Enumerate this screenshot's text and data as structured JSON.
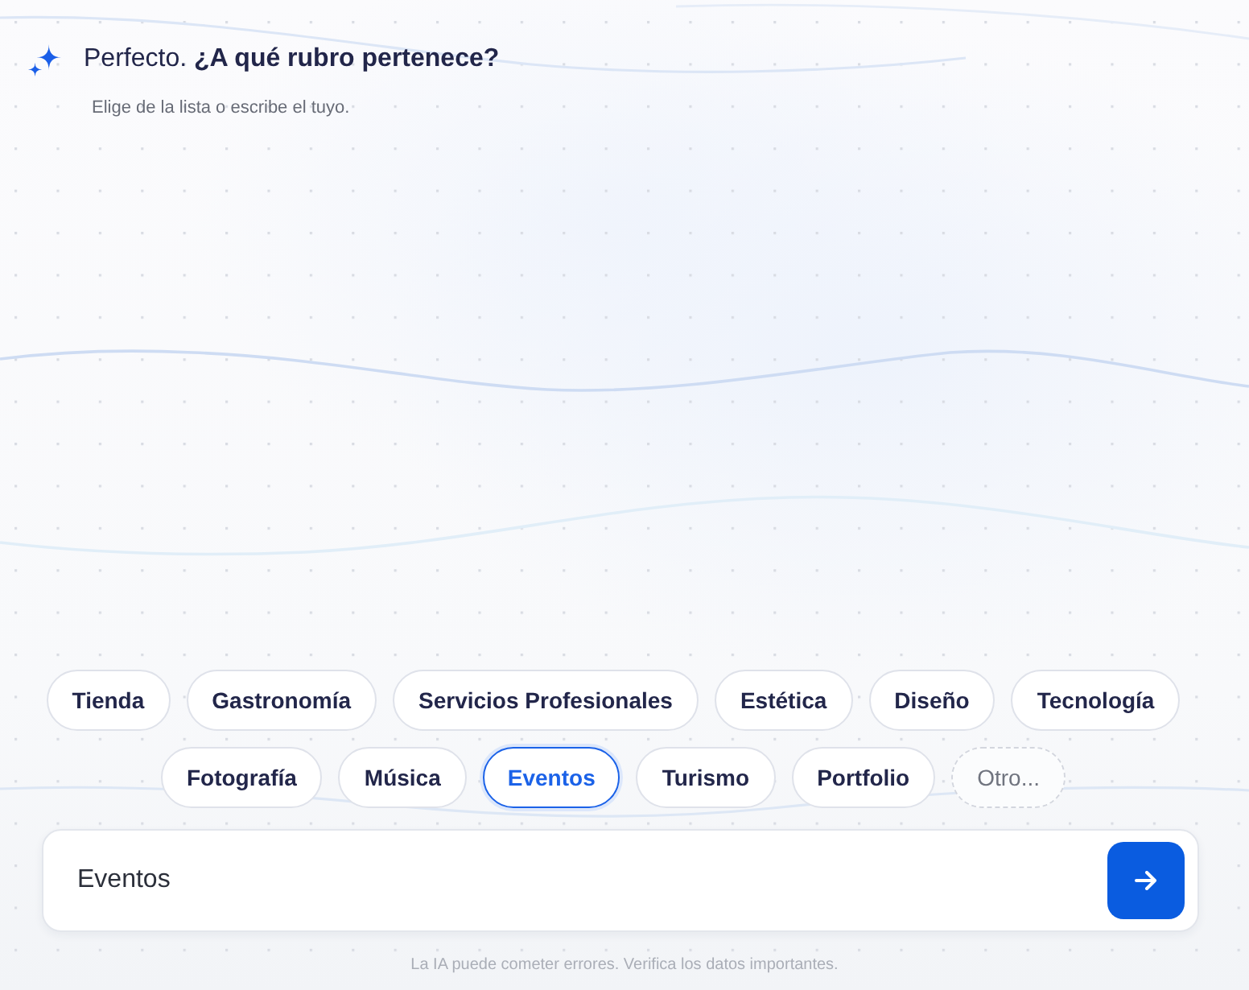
{
  "header": {
    "title": "Perfecto. **¿A qué rubro pertenece?**",
    "subtitle": "Elige de la lista o escribe el tuyo."
  },
  "options": [
    {
      "label": "Tienda",
      "kind": "option",
      "selected": false
    },
    {
      "label": "Gastronomía",
      "kind": "option",
      "selected": false
    },
    {
      "label": "Servicios Profesionales",
      "kind": "option",
      "selected": false
    },
    {
      "label": "Estética",
      "kind": "option",
      "selected": false
    },
    {
      "label": "Diseño",
      "kind": "option",
      "selected": false
    },
    {
      "label": "Tecnología",
      "kind": "option",
      "selected": false
    },
    {
      "label": "Fotografía",
      "kind": "option",
      "selected": false
    },
    {
      "label": "Música",
      "kind": "option",
      "selected": false
    },
    {
      "label": "Eventos",
      "kind": "option",
      "selected": true
    },
    {
      "label": "Turismo",
      "kind": "option",
      "selected": false
    },
    {
      "label": "Portfolio",
      "kind": "option",
      "selected": false
    },
    {
      "label": "Otro...",
      "kind": "other",
      "selected": false
    }
  ],
  "input": {
    "value": "Eventos"
  },
  "disclaimer": "La IA puede cometer errores. Verifica los datos importantes."
}
